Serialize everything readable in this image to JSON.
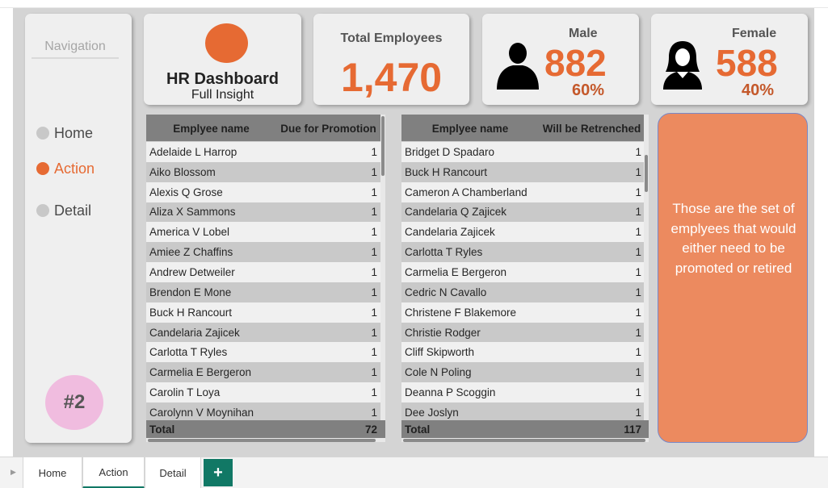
{
  "navigation": {
    "title": "Navigation",
    "items": [
      {
        "label": "Home",
        "active": false
      },
      {
        "label": "Action",
        "active": true
      },
      {
        "label": "Detail",
        "active": false
      }
    ],
    "badge": "#2"
  },
  "kpis": {
    "hr": {
      "title": "HR Dashboard",
      "subtitle": "Full Insight"
    },
    "total": {
      "label": "Total Employees",
      "value": "1,470"
    },
    "male": {
      "label": "Male",
      "value": "882",
      "percent": "60%",
      "icon": "male-person-icon"
    },
    "female": {
      "label": "Female",
      "value": "588",
      "percent": "40%",
      "icon": "female-person-icon"
    }
  },
  "promotion_table": {
    "headers": [
      "Emplyee name",
      "Due for Promotion"
    ],
    "rows": [
      {
        "name": "Adelaide L Harrop",
        "value": "1"
      },
      {
        "name": "Aiko Blossom",
        "value": "1"
      },
      {
        "name": "Alexis Q Grose",
        "value": "1"
      },
      {
        "name": "Aliza X Sammons",
        "value": "1"
      },
      {
        "name": "America V Lobel",
        "value": "1"
      },
      {
        "name": "Amiee Z Chaffins",
        "value": "1"
      },
      {
        "name": "Andrew Detweiler",
        "value": "1"
      },
      {
        "name": "Brendon E Mone",
        "value": "1"
      },
      {
        "name": "Buck H Rancourt",
        "value": "1"
      },
      {
        "name": "Candelaria Zajicek",
        "value": "1"
      },
      {
        "name": "Carlotta T Ryles",
        "value": "1"
      },
      {
        "name": "Carmelia E Bergeron",
        "value": "1"
      },
      {
        "name": "Carolin T Loya",
        "value": "1"
      },
      {
        "name": "Carolynn V Moynihan",
        "value": "1"
      }
    ],
    "total_label": "Total",
    "total_value": "72"
  },
  "retrenchment_table": {
    "headers": [
      "Emplyee name",
      "Will be Retrenched"
    ],
    "rows": [
      {
        "name": "Bridget D Spadaro",
        "value": "1"
      },
      {
        "name": "Buck H Rancourt",
        "value": "1"
      },
      {
        "name": "Cameron A Chamberland",
        "value": "1"
      },
      {
        "name": "Candelaria Q Zajicek",
        "value": "1"
      },
      {
        "name": "Candelaria Zajicek",
        "value": "1"
      },
      {
        "name": "Carlotta T Ryles",
        "value": "1"
      },
      {
        "name": "Carmelia E Bergeron",
        "value": "1"
      },
      {
        "name": "Cedric N Cavallo",
        "value": "1"
      },
      {
        "name": "Christene F Blakemore",
        "value": "1"
      },
      {
        "name": "Christie Rodger",
        "value": "1"
      },
      {
        "name": "Cliff Skipworth",
        "value": "1"
      },
      {
        "name": "Cole N Poling",
        "value": "1"
      },
      {
        "name": "Deanna P Scoggin",
        "value": "1"
      },
      {
        "name": "Dee Joslyn",
        "value": "1"
      }
    ],
    "total_label": "Total",
    "total_value": "117"
  },
  "note": {
    "text": "Those are the set of emplyees that would either need to be promoted or retired"
  },
  "tabs": {
    "items": [
      {
        "label": "Home",
        "active": false
      },
      {
        "label": "Action",
        "active": true
      },
      {
        "label": "Detail",
        "active": false
      }
    ],
    "add_label": "+"
  },
  "colors": {
    "accent": "#e66a33",
    "tab_accent": "#117865",
    "note_fill": "#ec8a5f",
    "badge_fill": "#f0bcdf"
  }
}
